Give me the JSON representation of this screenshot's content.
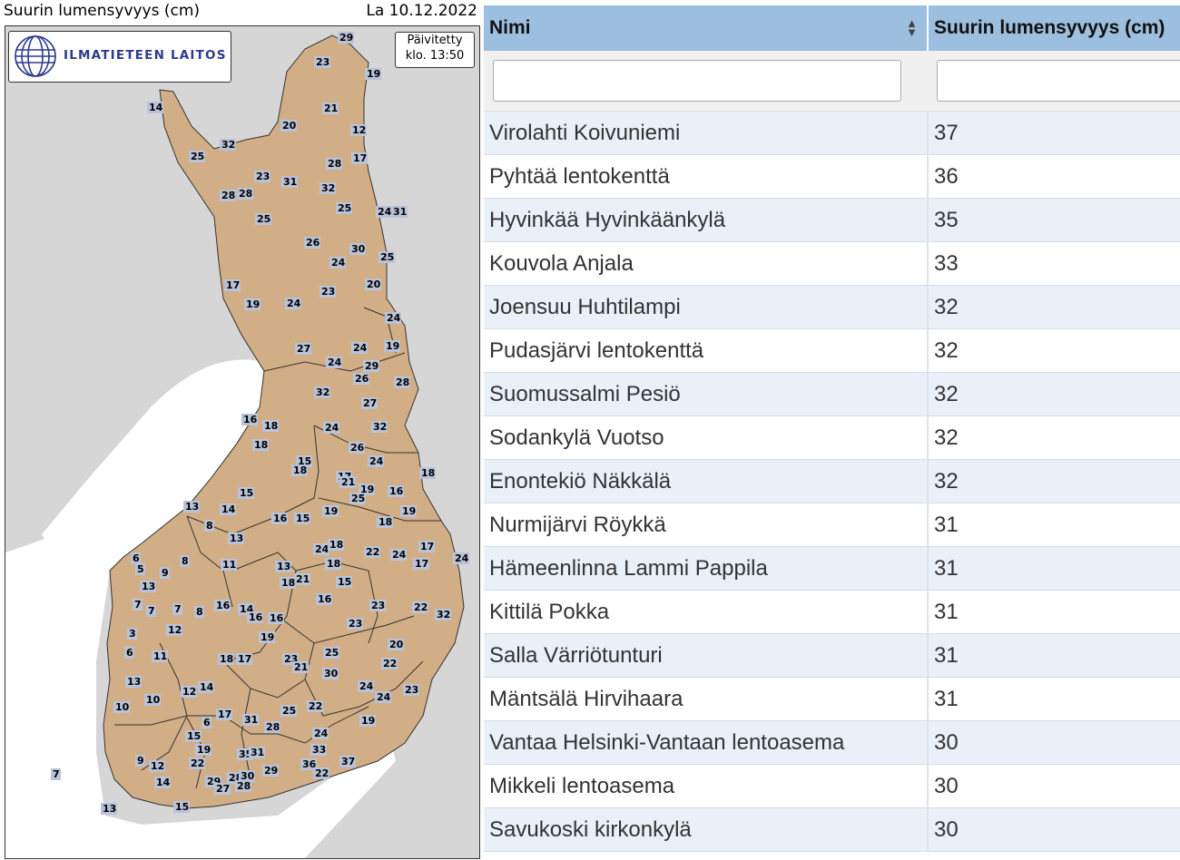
{
  "map": {
    "title": "Suurin lumensyvyys (cm)",
    "date": "La 10.12.2022",
    "logo_text": "ILMATIETEEN LAITOS",
    "updated_line1": "Päivitetty",
    "updated_line2": "klo. 13:50",
    "colors": {
      "land": "#d2ae86",
      "neighbor": "#d6d6d6",
      "sea": "#ffffff",
      "border": "#333333",
      "label_bg": "#b8c3d9"
    },
    "station_values": [
      "29",
      "23",
      "19",
      "21",
      "14",
      "20",
      "12",
      "32",
      "25",
      "17",
      "28",
      "23",
      "31",
      "32",
      "28",
      "28",
      "25",
      "24",
      "31",
      "25",
      "26",
      "30",
      "24",
      "25",
      "17",
      "19",
      "24",
      "23",
      "20",
      "24",
      "27",
      "24",
      "19",
      "24",
      "29",
      "26",
      "28",
      "32",
      "27",
      "16",
      "18",
      "24",
      "32",
      "18",
      "26",
      "24",
      "15",
      "18",
      "18",
      "17",
      "15",
      "21",
      "19",
      "16",
      "25",
      "13",
      "14",
      "16",
      "15",
      "19",
      "19",
      "8",
      "18",
      "13",
      "24",
      "18",
      "22",
      "24",
      "17",
      "6",
      "8",
      "11",
      "18",
      "17",
      "5",
      "9",
      "13",
      "21",
      "15",
      "24",
      "13",
      "16",
      "18",
      "7",
      "7",
      "7",
      "8",
      "16",
      "14",
      "16",
      "16",
      "23",
      "22",
      "32",
      "3",
      "12",
      "23",
      "19",
      "20",
      "6",
      "11",
      "18",
      "17",
      "23",
      "25",
      "22",
      "21",
      "30",
      "13",
      "12",
      "14",
      "24",
      "24",
      "23",
      "10",
      "10",
      "17",
      "31",
      "25",
      "22",
      "6",
      "15",
      "28",
      "19",
      "24",
      "19",
      "9",
      "12",
      "22",
      "35",
      "31",
      "36",
      "33",
      "37",
      "7",
      "14",
      "29",
      "28",
      "30",
      "29",
      "22",
      "13",
      "15",
      "27",
      "28"
    ]
  },
  "table": {
    "columns": {
      "name": "Nimi",
      "depth": "Suurin lumensyvyys (cm)"
    },
    "filters": {
      "name_placeholder": "",
      "depth_placeholder": ""
    },
    "rows": [
      {
        "name": "Virolahti Koivuniemi",
        "depth": "37"
      },
      {
        "name": "Pyhtää lentokenttä",
        "depth": "36"
      },
      {
        "name": "Hyvinkää Hyvinkäänkylä",
        "depth": "35"
      },
      {
        "name": "Kouvola Anjala",
        "depth": "33"
      },
      {
        "name": "Joensuu Huhtilampi",
        "depth": "32"
      },
      {
        "name": "Pudasjärvi lentokenttä",
        "depth": "32"
      },
      {
        "name": "Suomussalmi Pesiö",
        "depth": "32"
      },
      {
        "name": "Sodankylä Vuotso",
        "depth": "32"
      },
      {
        "name": "Enontekiö Näkkälä",
        "depth": "32"
      },
      {
        "name": "Nurmijärvi Röykkä",
        "depth": "31"
      },
      {
        "name": "Hämeenlinna Lammi Pappila",
        "depth": "31"
      },
      {
        "name": "Kittilä Pokka",
        "depth": "31"
      },
      {
        "name": "Salla Värriötunturi",
        "depth": "31"
      },
      {
        "name": "Mäntsälä Hirvihaara",
        "depth": "31"
      },
      {
        "name": "Vantaa Helsinki-Vantaan lentoasema",
        "depth": "30"
      },
      {
        "name": "Mikkeli lentoasema",
        "depth": "30"
      },
      {
        "name": "Savukoski kirkonkylä",
        "depth": "30"
      }
    ]
  }
}
